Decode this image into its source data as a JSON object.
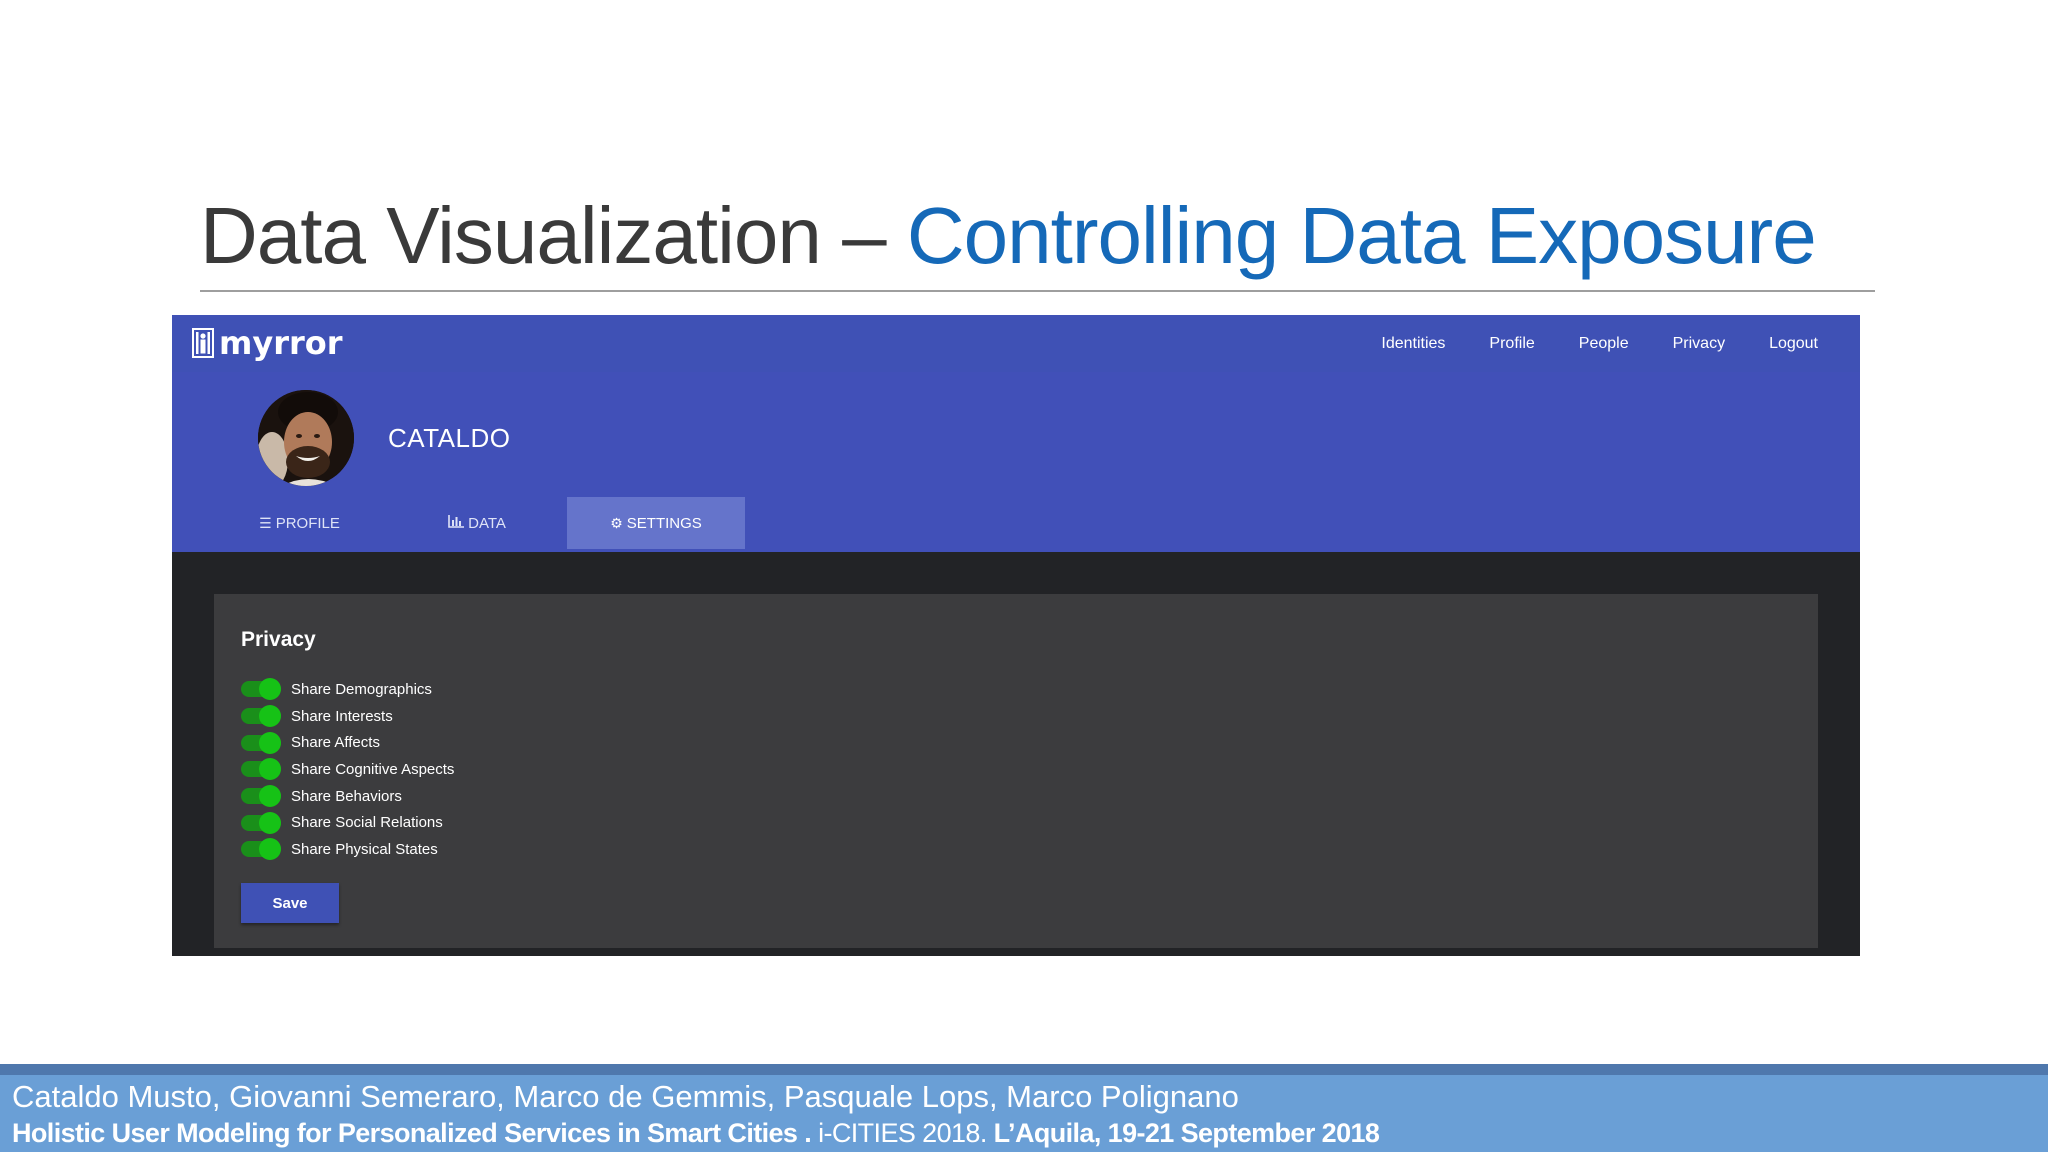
{
  "slide": {
    "title_main": "Data Visualization – ",
    "title_accent": "Controlling Data Exposure"
  },
  "app": {
    "logo_text": "myrror",
    "nav": [
      "Identities",
      "Profile",
      "People",
      "Privacy",
      "Logout"
    ],
    "user_name": "CATALDO",
    "tabs": [
      {
        "label": "PROFILE",
        "icon": "list-icon"
      },
      {
        "label": "DATA",
        "icon": "bar-chart-icon"
      },
      {
        "label": "SETTINGS",
        "icon": "gears-icon",
        "active": true
      }
    ],
    "privacy": {
      "title": "Privacy",
      "toggles": [
        {
          "label": "Share Demographics",
          "on": true
        },
        {
          "label": "Share Interests",
          "on": true
        },
        {
          "label": "Share Affects",
          "on": true
        },
        {
          "label": "Share Cognitive Aspects",
          "on": true
        },
        {
          "label": "Share Behaviors",
          "on": true
        },
        {
          "label": "Share Social Relations",
          "on": true
        },
        {
          "label": "Share Physical States",
          "on": true
        }
      ],
      "save_label": "Save"
    },
    "colors": {
      "primary": "#3f51b5",
      "toggle_on": "#16c216",
      "panel": "#3c3c3e"
    }
  },
  "footer": {
    "authors": "Cataldo Musto, Giovanni Semeraro, Marco de Gemmis, Pasquale Lops, Marco Polignano",
    "venue_bold_1": "Holistic User Modeling for Personalized Services in Smart Cities . ",
    "venue_regular": "i-CITIES 2018. ",
    "venue_bold_2": "L’Aquila, 19-21 September 2018"
  }
}
